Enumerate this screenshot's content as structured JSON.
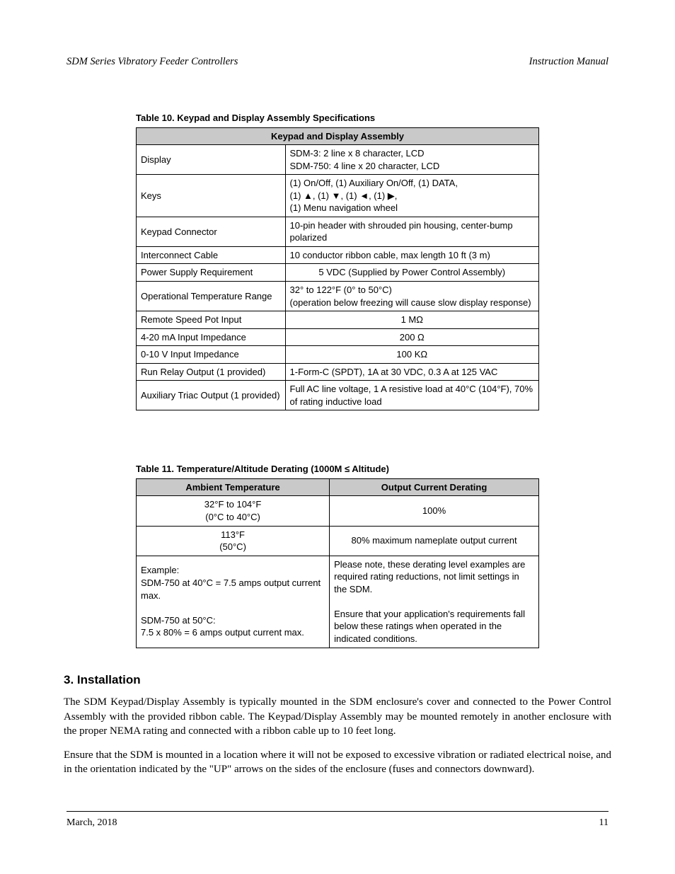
{
  "header": {
    "left": "SDM Series Vibratory Feeder Controllers",
    "right": "Instruction Manual"
  },
  "table1": {
    "caption": "Table 10.  Keypad and Display Assembly Specifications",
    "header": "Keypad and Display Assembly",
    "rows": [
      {
        "label": "Display",
        "value": "SDM-3: 2 line x 8 character, LCD\nSDM-750: 4 line x 20 character, LCD"
      },
      {
        "label": "Keys",
        "value": "(1) On/Off, (1) Auxiliary On/Off, (1) DATA,\n(1) ▲, (1) ▼, (1) ◄, (1) ▶,\n(1) Menu navigation wheel"
      },
      {
        "label": "Keypad Connector",
        "value": "10-pin header with shrouded pin housing, center-bump polarized"
      },
      {
        "label": "Interconnect Cable",
        "value": "10 conductor ribbon cable, max length 10 ft (3 m)"
      },
      {
        "label": "Power Supply Requirement",
        "value": "5 VDC (Supplied by Power Control Assembly)"
      },
      {
        "label": "Operational Temperature Range",
        "value": "32° to 122°F (0° to 50°C)\n(operation below freezing will cause slow display response)"
      },
      {
        "label": "Remote Speed Pot Input",
        "value": "1 MΩ"
      },
      {
        "label": "4-20 mA Input Impedance",
        "value": "200 Ω"
      },
      {
        "label": "0-10 V Input Impedance",
        "value": "100 KΩ"
      },
      {
        "label": "Run Relay Output (1 provided)",
        "value": "1-Form-C (SPDT), 1A at 30 VDC, 0.3 A at 125 VAC"
      },
      {
        "label": "Auxiliary Triac Output (1 provided)",
        "value": "Full AC line voltage, 1 A resistive load at 40°C (104°F), 70% of rating inductive load"
      }
    ]
  },
  "table2": {
    "caption_prefix": "Table 11.  Temperature/Altitude Derating (1000M ",
    "caption_suffix": " Altitude)",
    "col_a_header": "Ambient Temperature",
    "col_b_header": "Output Current Derating",
    "rows": [
      {
        "a": "32°F to 104°F\n(0°C to 40°C)",
        "b": "100%"
      },
      {
        "a": "113°F\n(50°C)",
        "b": "80% maximum nameplate output current"
      },
      {
        "a": "Example:\nSDM-750 at 40°C = 7.5 amps output current max.\n\nSDM-750 at 50°C:\n7.5 x 80% = 6 amps output current max.",
        "b": "Please note, these derating level examples are required rating reductions, not limit settings in the SDM.\n\nEnsure that your application's requirements fall below these ratings when operated in the indicated conditions."
      }
    ]
  },
  "section": {
    "heading": "3. Installation",
    "p1": "The SDM Keypad/Display Assembly is typically mounted in the SDM enclosure's cover and connected to the Power Control Assembly with the provided ribbon cable. The Keypad/Display Assembly may be mounted remotely in another enclosure with the proper NEMA rating and connected with a ribbon cable up to 10 feet long.",
    "p2": "Ensure that the SDM is mounted in a location where it will not be exposed to excessive vibration or radiated electrical noise, and in the orientation indicated by the \"UP\" arrows on the sides of the enclosure (fuses and connectors downward)."
  },
  "footer": {
    "left": "March, 2018",
    "right": "11"
  },
  "symbols": {
    "le": "≤",
    "omega": "Ω",
    "up": "▲",
    "down": "▼",
    "left": "◄",
    "right": "▶"
  }
}
